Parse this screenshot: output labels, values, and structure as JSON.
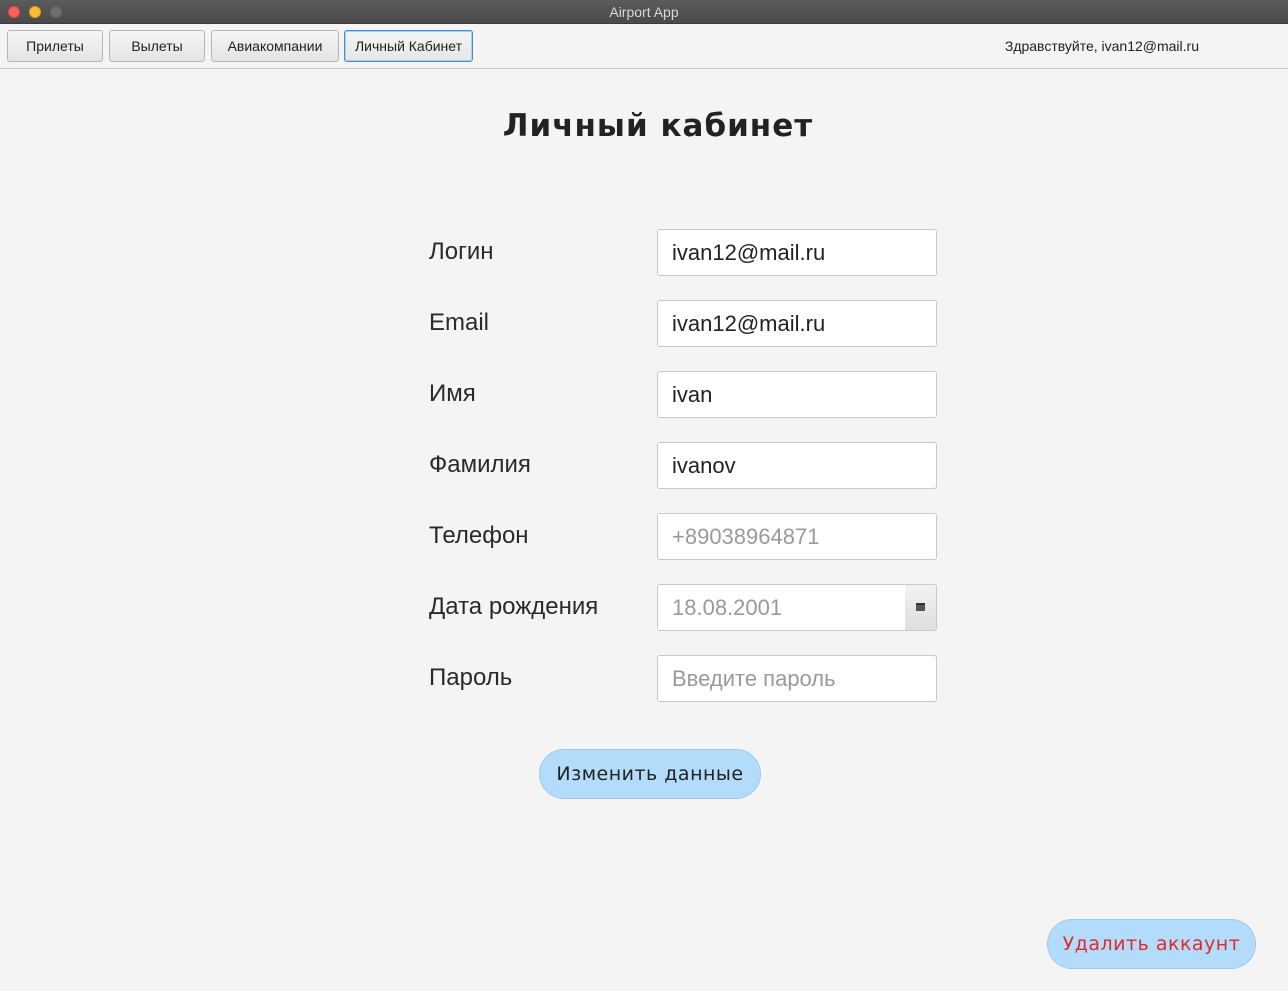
{
  "window": {
    "title": "Airport App"
  },
  "toolbar": {
    "tabs": [
      {
        "label": "Прилеты"
      },
      {
        "label": "Вылеты"
      },
      {
        "label": "Авиакомпании"
      },
      {
        "label": "Личный Кабинет"
      }
    ],
    "active_tab": "Личный Кабинет",
    "greeting": "Здравствуйте, ivan12@mail.ru"
  },
  "page": {
    "title": "Личный кабинет",
    "fields": {
      "login": {
        "label": "Логин",
        "value": "ivan12@mail.ru",
        "placeholder": ""
      },
      "email": {
        "label": "Email",
        "value": "ivan12@mail.ru",
        "placeholder": ""
      },
      "name": {
        "label": "Имя",
        "value": "ivan",
        "placeholder": ""
      },
      "surname": {
        "label": "Фамилия",
        "value": "ivanov",
        "placeholder": ""
      },
      "phone": {
        "label": "Телефон",
        "value": "",
        "placeholder": "+89038964871"
      },
      "birthdate": {
        "label": "Дата рождения",
        "value": "",
        "placeholder": "18.08.2001"
      },
      "password": {
        "label": "Пароль",
        "value": "",
        "placeholder": "Введите пароль"
      }
    },
    "edit_button": "Изменить данные",
    "delete_button": "Удалить аккаунт"
  },
  "colors": {
    "accent_button": "#b3dcfb",
    "danger_text": "#e2282f",
    "active_tab_border": "#3b8fd6"
  }
}
